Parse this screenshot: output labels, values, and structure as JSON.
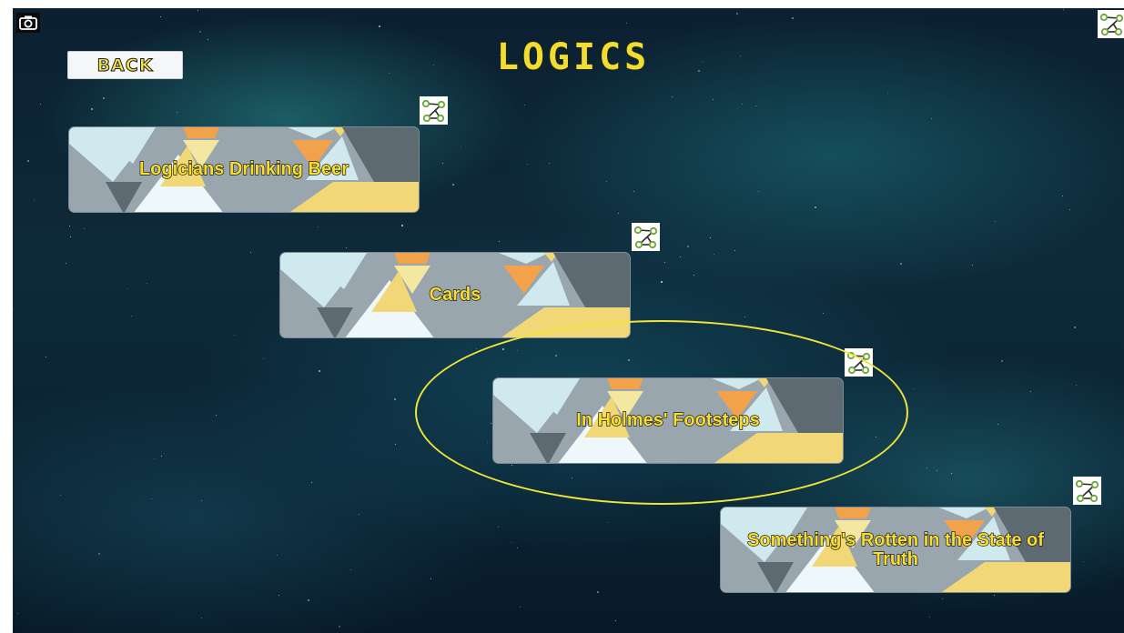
{
  "screen": {
    "title": "LOGICS"
  },
  "toolbar": {
    "back_label": "BACK",
    "screenshot_icon": "camera-icon",
    "top_right_icon": "graph-icon"
  },
  "levels": [
    {
      "label": "Logicians Drinking Beer",
      "icon": "graph-icon"
    },
    {
      "label": "Cards",
      "icon": "graph-icon"
    },
    {
      "label": "In Holmes' Footsteps",
      "icon": "graph-icon",
      "highlighted": true
    },
    {
      "label": "Something's Rotten in the State of Truth",
      "icon": "graph-icon"
    }
  ],
  "colors": {
    "title": "#f2dc32",
    "label": "#f6dd2f",
    "highlight": "#f0e43a"
  }
}
